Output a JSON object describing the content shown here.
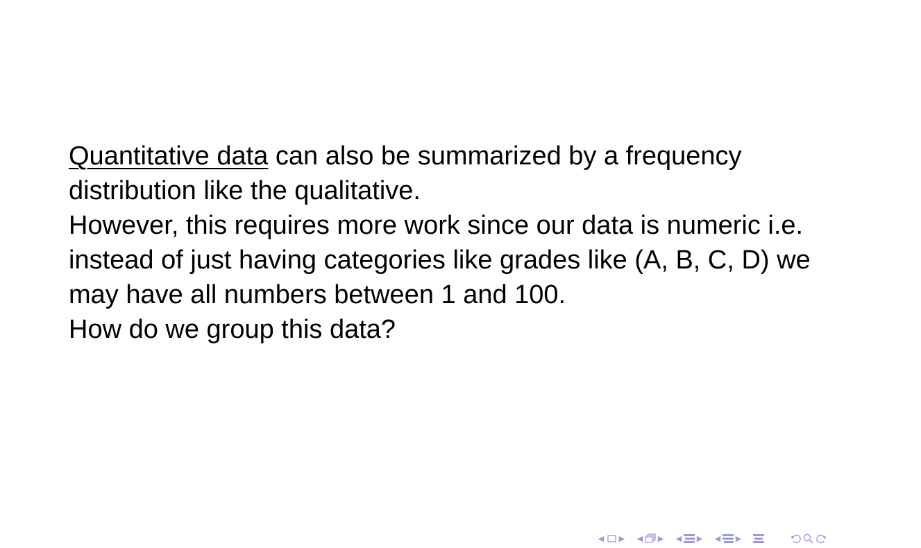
{
  "slide": {
    "lines": [
      {
        "underlined": "Quantitative data",
        "rest": " can also be summarized by a frequency"
      },
      {
        "text": "distribution like the qualitative."
      },
      {
        "text": "However, this requires more work since our data is numeric i.e."
      },
      {
        "text": "instead of just having categories like grades like (A, B, C, D) we"
      },
      {
        "text": "may have all numbers between 1 and 100."
      },
      {
        "text": "How do we group this data?"
      }
    ]
  },
  "navigation": {
    "icons": [
      "frame-nav-icon",
      "subsection-nav-icon",
      "section-nav-icon",
      "presentation-nav-icon",
      "document-nav-icon",
      "back-icon",
      "search-icon",
      "forward-icon"
    ],
    "color": "#9b9bd6"
  }
}
